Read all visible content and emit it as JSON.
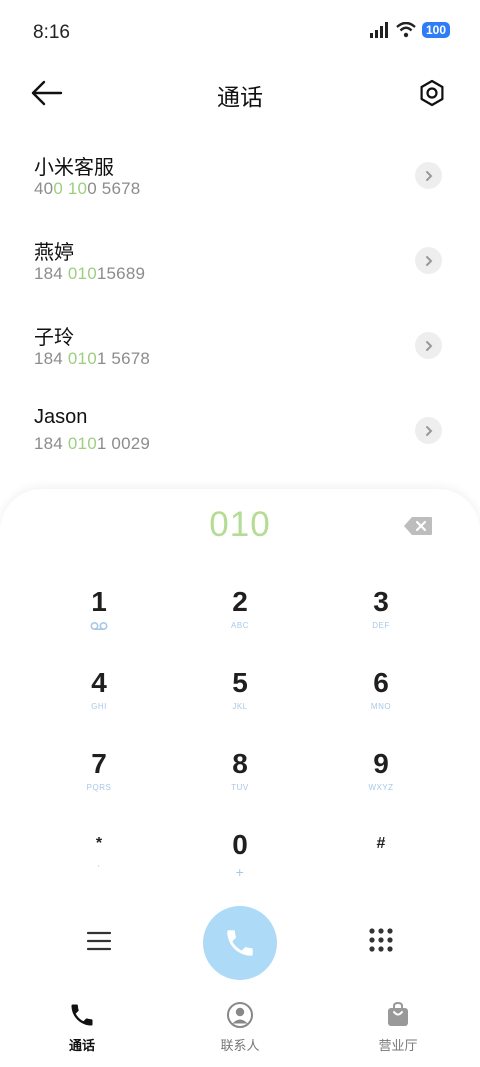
{
  "status": {
    "time": "8:16",
    "battery": "100"
  },
  "header": {
    "title": "通话"
  },
  "contacts": [
    {
      "name": "小米客服",
      "number_parts": [
        "40",
        "0",
        " ",
        "10",
        "0 5678"
      ]
    },
    {
      "name": "燕婷",
      "number_parts": [
        "184 ",
        "010",
        "15689",
        "",
        ""
      ]
    },
    {
      "name": "子玲",
      "number_parts": [
        "184 ",
        "010",
        "1 5678",
        "",
        ""
      ]
    },
    {
      "name": "Jason",
      "number_parts": [
        "184 ",
        "010",
        "1 0029",
        "",
        ""
      ]
    }
  ],
  "dialer": {
    "input": "010",
    "keys": [
      {
        "digit": "1",
        "sub": ""
      },
      {
        "digit": "2",
        "sub": "ABC"
      },
      {
        "digit": "3",
        "sub": "DEF"
      },
      {
        "digit": "4",
        "sub": "GHI"
      },
      {
        "digit": "5",
        "sub": "JKL"
      },
      {
        "digit": "6",
        "sub": "MNO"
      },
      {
        "digit": "7",
        "sub": "PQRS"
      },
      {
        "digit": "8",
        "sub": "TUV"
      },
      {
        "digit": "9",
        "sub": "WXYZ"
      },
      {
        "digit": "*",
        "sub": ","
      },
      {
        "digit": "0",
        "sub": "+"
      },
      {
        "digit": "#",
        "sub": ""
      }
    ]
  },
  "nav": {
    "items": [
      {
        "label": "通话"
      },
      {
        "label": "联系人"
      },
      {
        "label": "营业厅"
      }
    ]
  },
  "colors": {
    "accent": "#b4dc94",
    "call": "#addaf7",
    "keysub": "#a8c8e8"
  }
}
